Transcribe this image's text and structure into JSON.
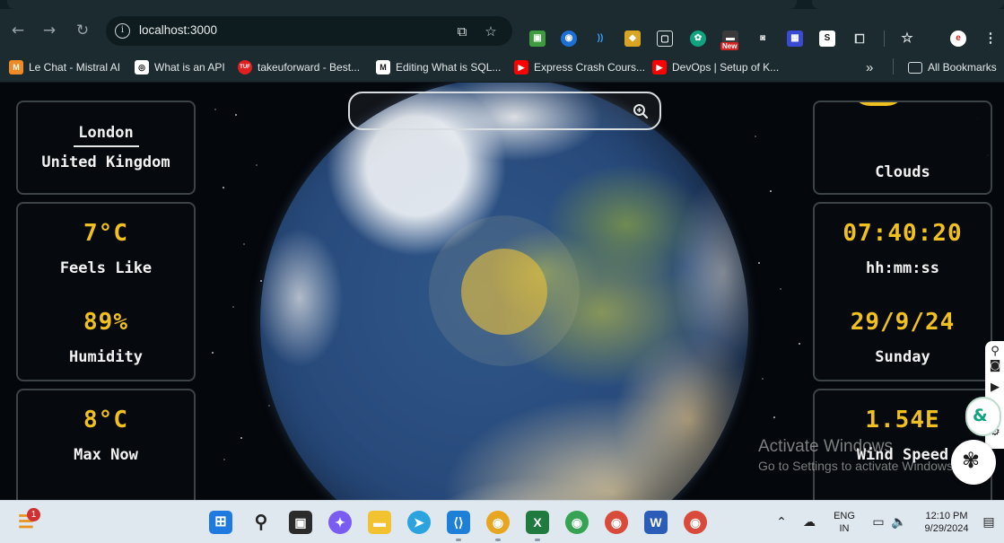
{
  "browser": {
    "url": "localhost:3000",
    "bookmarks": [
      {
        "label": "Le Chat - Mistral AI",
        "icon": "mistral-icon",
        "color": "#f08a24",
        "glyph": "M"
      },
      {
        "label": "What is an API",
        "icon": "openai-icon",
        "color": "#ffffff",
        "glyph": "◎"
      },
      {
        "label": "takeuforward - Best...",
        "icon": "tuf-icon",
        "color": "#e02020",
        "glyph": "TUF"
      },
      {
        "label": "Editing What is SQL...",
        "icon": "medium-icon",
        "color": "#111111",
        "glyph": "M"
      },
      {
        "label": "Express Crash Cours...",
        "icon": "youtube-icon",
        "color": "#ff0000",
        "glyph": "▶"
      },
      {
        "label": "DevOps | Setup of K...",
        "icon": "youtube-icon",
        "color": "#ff0000",
        "glyph": "▶"
      }
    ],
    "overflow": "»",
    "all_bookmarks": "All Bookmarks",
    "new_badge": "New"
  },
  "search": {
    "placeholder": "",
    "value": ""
  },
  "left_panel": {
    "city": "London",
    "country": "United Kingdom",
    "temperature": "7°C",
    "feels_like_label": "Feels Like",
    "humidity": "89%",
    "humidity_label": "Humidity",
    "max_temp": "8°C",
    "max_label": "Max Now"
  },
  "right_panel": {
    "weather": "Clouds",
    "time": "07:40:20",
    "time_format": "hh:mm:ss",
    "date": "29/9/24",
    "day": "Sunday",
    "wind": "1.54E",
    "wind_label": "Wind Speed"
  },
  "watermark": {
    "title": "Activate Windows",
    "subtitle": "Go to Settings to activate Windows."
  },
  "taskbar": {
    "notification_count": "1",
    "lang_primary": "ENG",
    "lang_secondary": "IN",
    "time": "12:10 PM",
    "date": "9/29/2024"
  },
  "colors": {
    "accent_yellow": "#f0c020",
    "card_border": "#3c4448"
  }
}
